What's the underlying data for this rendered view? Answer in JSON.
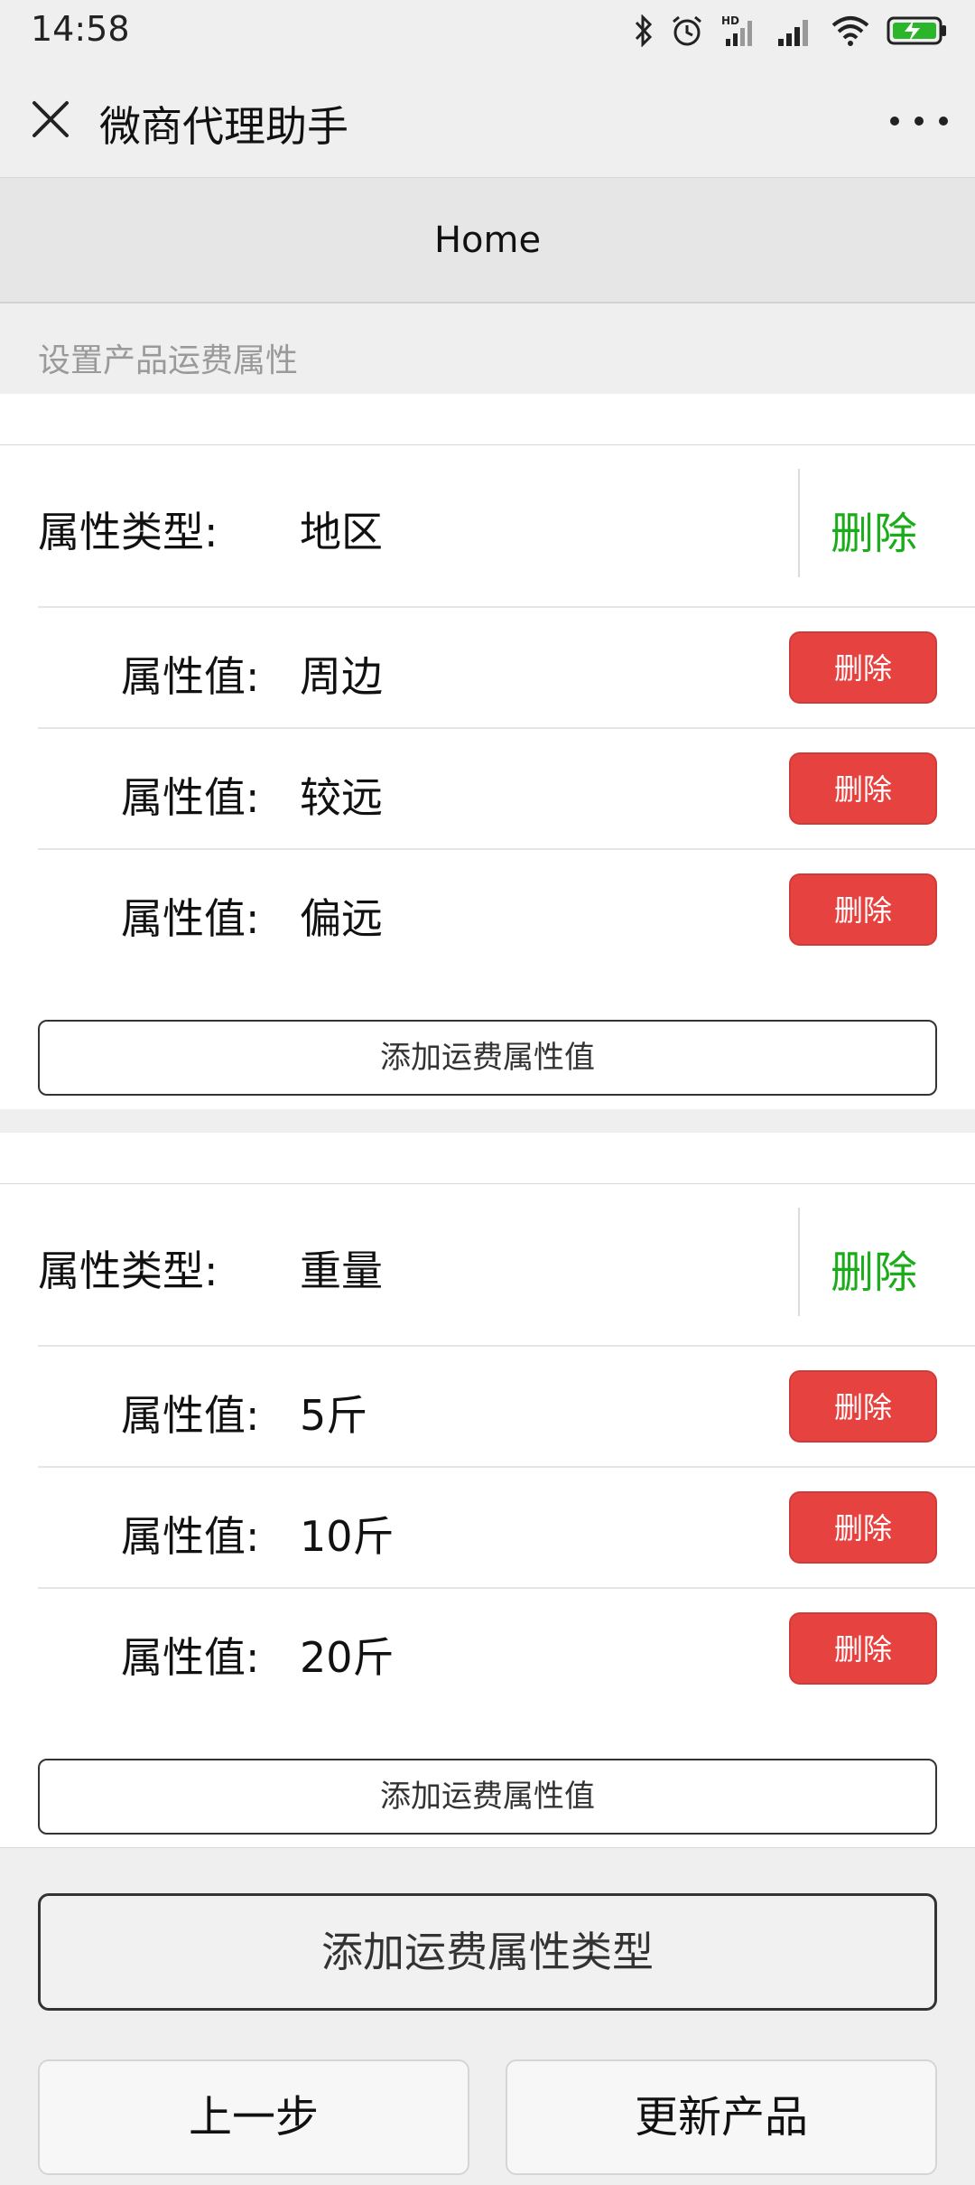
{
  "status_bar": {
    "time": "14:58",
    "icons": [
      "bluetooth-icon",
      "alarm-icon",
      "hd-signal-icon",
      "signal-icon",
      "wifi-icon",
      "battery-charging-icon"
    ]
  },
  "title_bar": {
    "title": "微商代理助手",
    "close_icon": "close-icon",
    "more_icon": "more-icon"
  },
  "nav": {
    "title": "Home"
  },
  "section": {
    "title": "设置产品运费属性"
  },
  "colors": {
    "green": "#1aad19",
    "red": "#e64340"
  },
  "attribute_types": [
    {
      "label": "属性类型:",
      "value": "地区",
      "delete_label": "删除",
      "values": [
        {
          "label": "属性值:",
          "value": "周边",
          "delete_label": "删除"
        },
        {
          "label": "属性值:",
          "value": "较远",
          "delete_label": "删除"
        },
        {
          "label": "属性值:",
          "value": "偏远",
          "delete_label": "删除"
        }
      ],
      "add_value_label": "添加运费属性值"
    },
    {
      "label": "属性类型:",
      "value": "重量",
      "delete_label": "删除",
      "values": [
        {
          "label": "属性值:",
          "value": "5斤",
          "delete_label": "删除"
        },
        {
          "label": "属性值:",
          "value": "10斤",
          "delete_label": "删除"
        },
        {
          "label": "属性值:",
          "value": "20斤",
          "delete_label": "删除"
        }
      ],
      "add_value_label": "添加运费属性值"
    }
  ],
  "actions": {
    "add_type_label": "添加运费属性类型",
    "prev_label": "上一步",
    "update_label": "更新产品"
  }
}
